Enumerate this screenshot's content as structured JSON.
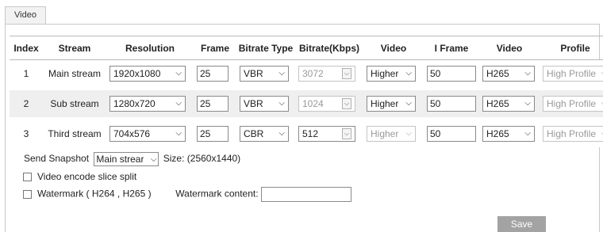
{
  "tab": {
    "label": "Video"
  },
  "table": {
    "headers": [
      "Index",
      "Stream",
      "Resolution",
      "Frame",
      "Bitrate Type",
      "Bitrate(Kbps)",
      "Video",
      "I Frame",
      "Video",
      "Profile"
    ],
    "rows": [
      {
        "index": "1",
        "stream": "Main stream",
        "resolution": "1920x1080",
        "frame": "25",
        "bitrate_type": "VBR",
        "bitrate": "3072",
        "video_quality": "Higher",
        "iframe": "50",
        "encoding": "H265",
        "profile": "High Profile"
      },
      {
        "index": "2",
        "stream": "Sub stream",
        "resolution": "1280x720",
        "frame": "25",
        "bitrate_type": "VBR",
        "bitrate": "1024",
        "video_quality": "Higher",
        "iframe": "50",
        "encoding": "H265",
        "profile": "High Profile"
      },
      {
        "index": "3",
        "stream": "Third stream",
        "resolution": "704x576",
        "frame": "25",
        "bitrate_type": "CBR",
        "bitrate": "512",
        "video_quality": "Higher",
        "iframe": "50",
        "encoding": "H265",
        "profile": "High Profile"
      }
    ]
  },
  "snapshot": {
    "label": "Send Snapshot",
    "value": "Main strear",
    "size_text": "Size: (2560x1440)"
  },
  "slice_split": {
    "label": "Video encode slice split",
    "checked": false
  },
  "watermark": {
    "label": "Watermark ( H264 , H265 )",
    "content_label": "Watermark content:",
    "content_value": "",
    "checked": false
  },
  "save_label": "Save",
  "colors": {
    "row_alt": "#efefef",
    "save_bg": "#a3a3a3",
    "disabled_text": "#9a9a9a"
  }
}
